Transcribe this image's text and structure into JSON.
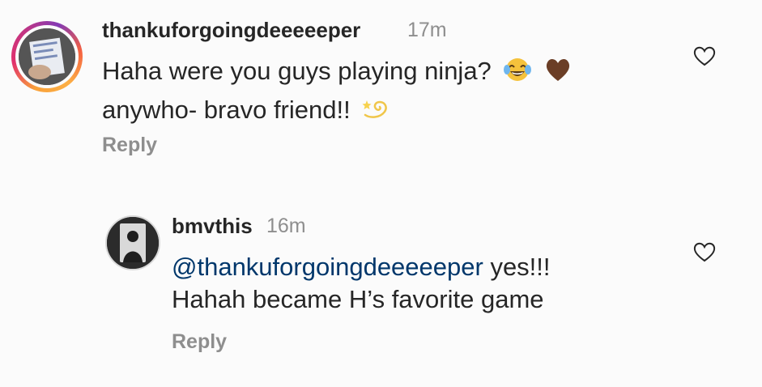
{
  "comments": [
    {
      "username": "thankuforgoingdeeeeeper",
      "time": "17m",
      "text_line1": "Haha were you guys playing ninja?",
      "text_line2": "anywho- bravo friend!!",
      "emojis": [
        "face-with-tears-of-joy-emoji",
        "brown-heart-emoji",
        "dizzy-emoji"
      ],
      "reply_label": "Reply",
      "avatar_ring": true
    },
    {
      "username": "bmvthis",
      "time": "16m",
      "mention": "@thankuforgoingdeeeeeper",
      "text_line1_rest": " yes!!!",
      "text_line2": "Hahah became H’s favorite game",
      "reply_label": "Reply",
      "is_reply": true
    }
  ],
  "icons": {
    "like": "heart-outline-icon"
  },
  "colors": {
    "background": "#fbfbfb",
    "text": "#262626",
    "secondary_text": "#8e8e8e",
    "mention": "#00376b",
    "story_ring": [
      "#f9a13a",
      "#e1306c",
      "#833ab4"
    ],
    "brown_heart": "#6b3e26",
    "joy_emoji": "#f5c23c"
  }
}
